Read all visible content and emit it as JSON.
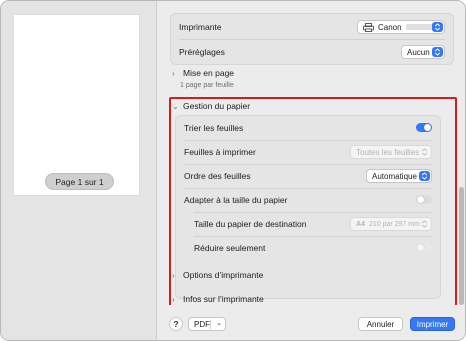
{
  "preview": {
    "page_label": "Page 1 sur 1"
  },
  "printer": {
    "label": "Imprimante",
    "value": "Canon"
  },
  "presets": {
    "label": "Préréglages",
    "value": "Aucun"
  },
  "layout_section": {
    "title": "Mise en page",
    "summary": "1 page par feuille"
  },
  "paper_section": {
    "title": "Gestion du papier",
    "collate": {
      "label": "Trier les feuilles",
      "state": "on"
    },
    "pages_to_print": {
      "label": "Feuilles à imprimer",
      "value": "Toutes les feuilles"
    },
    "page_order": {
      "label": "Ordre des feuilles",
      "value": "Automatique"
    },
    "scale_to_fit": {
      "label": "Adapter à la taille du papier",
      "state": "off"
    },
    "destination_size": {
      "label": "Taille du papier de destination",
      "size_code": "A4",
      "size_value": "210 par 297 mm"
    },
    "scale_down_only": {
      "label": "Réduire seulement",
      "state": "off"
    }
  },
  "printer_options_section": {
    "title": "Options d’imprimante"
  },
  "printer_info_section": {
    "title": "Infos sur l’imprimante"
  },
  "footer": {
    "help": "?",
    "pdf": "PDF",
    "cancel": "Annuler",
    "print": "Imprimer"
  },
  "colors": {
    "accent": "#3478f6",
    "highlight_border": "#d51c1c"
  }
}
